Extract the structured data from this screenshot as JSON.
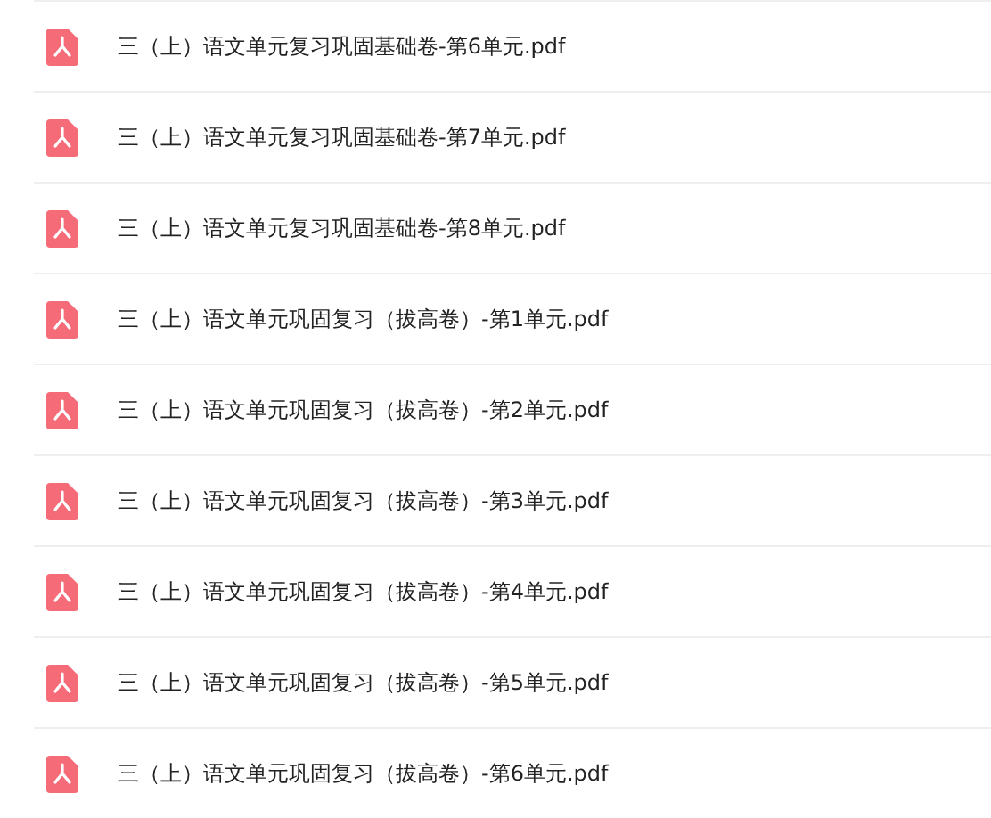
{
  "files": [
    {
      "name": "三（上）语文单元复习巩固基础卷-第6单元.pdf"
    },
    {
      "name": "三（上）语文单元复习巩固基础卷-第7单元.pdf"
    },
    {
      "name": "三（上）语文单元复习巩固基础卷-第8单元.pdf"
    },
    {
      "name": "三（上）语文单元巩固复习（拔高卷）-第1单元.pdf"
    },
    {
      "name": "三（上）语文单元巩固复习（拔高卷）-第2单元.pdf"
    },
    {
      "name": "三（上）语文单元巩固复习（拔高卷）-第3单元.pdf"
    },
    {
      "name": "三（上）语文单元巩固复习（拔高卷）-第4单元.pdf"
    },
    {
      "name": "三（上）语文单元巩固复习（拔高卷）-第5单元.pdf"
    },
    {
      "name": "三（上）语文单元巩固复习（拔高卷）-第6单元.pdf"
    }
  ]
}
